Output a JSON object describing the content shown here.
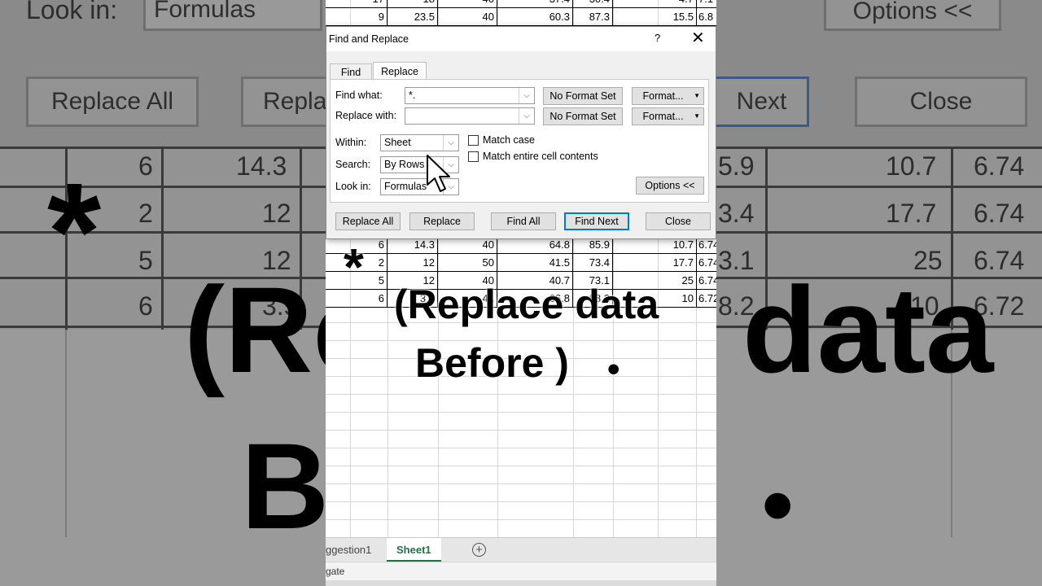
{
  "background": {
    "look_in_label": "Look in:",
    "look_in_value": "Formulas",
    "options_button": "Options <<",
    "replace_all_button": "Replace All",
    "replace_button": "Repla",
    "find_next_button": "Next",
    "close_button": "Close",
    "cells_left": [
      "6",
      "2",
      "5",
      "6"
    ],
    "cells_mid": [
      "14.3",
      "12",
      "12",
      "3.5"
    ],
    "cells_right_a": [
      "5.9",
      "3.4",
      "3.1",
      "8.2"
    ],
    "cells_right_b": [
      "10.7",
      "17.7",
      "25",
      "10"
    ],
    "cells_right_c": [
      "6.74",
      "6.74",
      "6.74",
      "6.72"
    ],
    "big_asterisk": "*",
    "big_line1": "(Re",
    "big_line1b": "data",
    "big_line2": "B",
    "big_dot": "•"
  },
  "sheet": {
    "top_rows": [
      [
        "17",
        "18",
        "40",
        "37.4",
        "30.4",
        "4.7",
        "7.1"
      ],
      [
        "9",
        "23.5",
        "40",
        "60.3",
        "87.3",
        "15.5",
        "6.8"
      ]
    ],
    "rows": [
      [
        "6",
        "14.3",
        "40",
        "64.8",
        "85.9",
        "10.7",
        "6.74"
      ],
      [
        "2",
        "12",
        "50",
        "41.5",
        "73.4",
        "17.7",
        "6.74"
      ],
      [
        "5",
        "12",
        "40",
        "40.7",
        "73.1",
        "25",
        "6.74"
      ],
      [
        "6",
        "3.5",
        "41",
        "66.8",
        "88.2",
        "10",
        "6.72"
      ]
    ]
  },
  "caption": {
    "asterisk": "*",
    "line1": "(Replace data",
    "line2": "Before )",
    "dot": "•"
  },
  "dialog": {
    "title": "Find and Replace",
    "help": "?",
    "close": "✕",
    "tab_find": "Find",
    "tab_replace": "Replace",
    "find_what_label": "Find what:",
    "find_what_value": "*.",
    "replace_with_label": "Replace with:",
    "replace_with_value": "",
    "no_format_set_1": "No Format Set",
    "no_format_set_2": "No Format Set",
    "format_button_1": "Format...",
    "format_button_2": "Format...",
    "within_label": "Within:",
    "within_value": "Sheet",
    "search_label": "Search:",
    "search_value": "By Rows",
    "look_in_label": "Look in:",
    "look_in_value": "Formulas",
    "match_case": "Match case",
    "match_entire": "Match entire cell contents",
    "options_button": "Options <<",
    "replace_all": "Replace All",
    "replace": "Replace",
    "find_all": "Find All",
    "find_next": "Find Next",
    "close_button": "Close"
  },
  "tabs": {
    "sheet_prev": "ggestion1",
    "sheet_active": "Sheet1",
    "add": "+"
  },
  "status": {
    "text": "gate"
  }
}
